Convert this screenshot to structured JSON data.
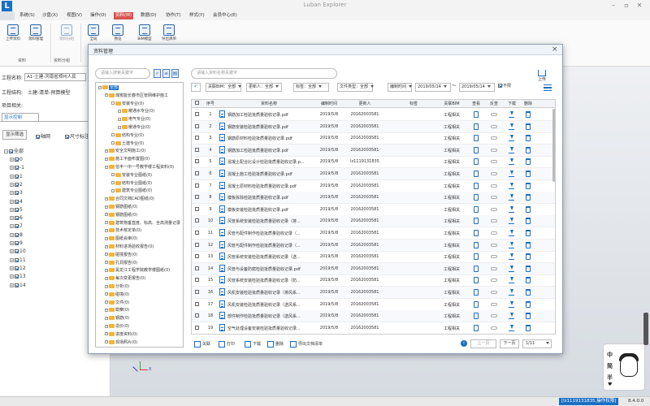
{
  "app": {
    "title": "Luban Explorer",
    "logo": "L"
  },
  "menu": [
    "系统(S)",
    "沙盘(X)",
    "视图(V)",
    "操作(O)",
    "资料(M)",
    "数据(D)",
    "协作(T)",
    "样式(Y)",
    "会员中心(E)"
  ],
  "menu_active": 4,
  "ribbon": {
    "buttons": [
      "上传资料",
      "资料管理",
      "资料分组",
      "全局",
      "预览",
      "BIM模型",
      "导出清单"
    ],
    "groups": [
      "资料",
      "资料分组"
    ]
  },
  "left": {
    "project_label": "工程名称:",
    "project_value": "A1-土建-河南省郑州人民",
    "struct_label": "工程结构:",
    "struct_value": "土建-清单-预算模型",
    "item_label": "项目相关:",
    "tab": "显示控制",
    "btn_filter": "显示筛选",
    "cb_grid": "轴网",
    "cb_size": "尺寸标注",
    "tree_root": "全部",
    "tree_items": [
      "0",
      "-1",
      "1",
      "2",
      "3",
      "4",
      "5",
      "6",
      "7",
      "8",
      "9",
      "10",
      "11",
      "12",
      "13",
      "14"
    ]
  },
  "dialog": {
    "title": "资料管理",
    "close": "×",
    "tree_search_placeholder": "请输入搜索关键字",
    "table_search_placeholder": "请输入资料名称关键字",
    "upload": "上传",
    "filters": [
      "关联BIM：全部",
      "更新人：全部",
      "标签：全部",
      "文件类型：全部",
      "编制时间"
    ],
    "date_from": "2019/05/14",
    "date_sep": "～",
    "date_to": "2019/05/14",
    "cb_unlimited": "不限",
    "tree": [
      {
        "label": "全部",
        "level": 0,
        "selected": true
      },
      {
        "label": "煤炭能长春市区管网维护施工",
        "level": 1
      },
      {
        "label": "安装专业(0)",
        "level": 2
      },
      {
        "label": "暖通水专业(0)",
        "level": 3
      },
      {
        "label": "电气专业(0)",
        "level": 3
      },
      {
        "label": "暖通专业(0)",
        "level": 3
      },
      {
        "label": "结构专业(0)",
        "level": 2
      },
      {
        "label": "土建专业(0)",
        "level": 2
      },
      {
        "label": "安全文明施工(0)",
        "level": 1
      },
      {
        "label": "施工平面布置图(0)",
        "level": 1
      },
      {
        "label": "信丰一中一号教学楼工程资料(0)",
        "level": 1
      },
      {
        "label": "安装专业图纸(0)",
        "level": 2
      },
      {
        "label": "结构专业图纸(0)",
        "level": 2
      },
      {
        "label": "建筑专业图纸(0)",
        "level": 2
      },
      {
        "label": "合同文档CAD图纸(0)",
        "level": 1
      },
      {
        "label": "钢筋图纸(0)",
        "level": 1
      },
      {
        "label": "钢筋图纸(0)",
        "level": 1
      },
      {
        "label": "建筑物垂直度、标高、全高测量记录",
        "level": 1
      },
      {
        "label": "技术核定单(0)",
        "level": 1
      },
      {
        "label": "图纸会审(0)",
        "level": 1
      },
      {
        "label": "材料进场验收报告(0)",
        "level": 1
      },
      {
        "label": "碰撞报告(0)",
        "level": 1
      },
      {
        "label": "孔洞报告(0)",
        "level": 1
      },
      {
        "label": "黑龙江工程学院教学楼图纸(0)",
        "level": 1
      },
      {
        "label": "每次变更报告(0)",
        "level": 1
      },
      {
        "label": "分析(0)",
        "level": 1
      },
      {
        "label": "碰撞(0)",
        "level": 1
      },
      {
        "label": "文件(0)",
        "level": 1
      },
      {
        "label": "勘察(0)",
        "level": 1
      },
      {
        "label": "钢筋(0)",
        "level": 1
      },
      {
        "label": "造价(0)",
        "level": 1
      },
      {
        "label": "进度资料(0)",
        "level": 1
      },
      {
        "label": "现场照片(0)",
        "level": 1
      }
    ],
    "columns": [
      "序号",
      "资料名称",
      "编制时间",
      "更新人",
      "标签",
      "关联BIM",
      "查看",
      "反查",
      "下载",
      "删除"
    ],
    "rows": [
      {
        "no": "1",
        "name": "钢筋加工检验批质量验收记录.pdf",
        "date": "2019/5/8",
        "user": "20162003581",
        "bim": "工程相关"
      },
      {
        "no": "2",
        "name": "钢筋安装检验批质量验收记录.pdf",
        "date": "2019/5/8",
        "user": "20162003581",
        "bim": "工程相关"
      },
      {
        "no": "3",
        "name": "钢筋原材料检验批质量验收记录.pdf",
        "date": "2019/5/8",
        "user": "20162003581",
        "bim": "工程相关"
      },
      {
        "no": "4",
        "name": "钢筋加工检验批质量验收记录.pdf",
        "date": "2019/5/8",
        "user": "20162003581",
        "bim": "工程相关"
      },
      {
        "no": "5",
        "name": "混凝土配合比设计检验批质量验收记录.p...",
        "date": "2019/5/8",
        "user": "lz1119131835",
        "bim": "工程相关"
      },
      {
        "no": "6",
        "name": "混凝土施工检验批质量验收记录.pdf",
        "date": "2019/5/8",
        "user": "20162003581",
        "bim": "工程相关"
      },
      {
        "no": "7",
        "name": "混凝土原材料检验批质量验收记录.pdf",
        "date": "2019/5/8",
        "user": "20162003581",
        "bim": "工程相关"
      },
      {
        "no": "8",
        "name": "模板拆除检验批质量验收记录.pdf",
        "date": "2019/5/8",
        "user": "20162003581",
        "bim": "工程相关"
      },
      {
        "no": "9",
        "name": "模板安装检验批质量验收记录.pdf",
        "date": "2019/5/8",
        "user": "20162003581",
        "bim": "工程相关"
      },
      {
        "no": "10",
        "name": "风管系统安装检验批质量验收记录（排...",
        "date": "2019/5/8",
        "user": "20162003581",
        "bim": "工程相关"
      },
      {
        "no": "11",
        "name": "风管与配件制作检验批质量验收记录（...",
        "date": "2019/5/8",
        "user": "20162003581",
        "bim": "工程相关"
      },
      {
        "no": "12",
        "name": "风管与配件制作检验批质量验收记录（...",
        "date": "2019/5/8",
        "user": "20162003581",
        "bim": "工程相关"
      },
      {
        "no": "13",
        "name": "风管系统安装检验批质量验收记录（送...",
        "date": "2019/5/8",
        "user": "20162003581",
        "bim": "工程相关"
      },
      {
        "no": "14",
        "name": "风管与设备防腐检验批质量验收记录.pdf",
        "date": "2019/5/8",
        "user": "20162003581",
        "bim": "工程相关"
      },
      {
        "no": "15",
        "name": "风管系统安装检验批质量验收记录（防...",
        "date": "2019/5/8",
        "user": "20162003581",
        "bim": "工程相关"
      },
      {
        "no": "16",
        "name": "风机安装检验批质量验收记录（排风系...",
        "date": "2019/5/8",
        "user": "20162003581",
        "bim": "工程相关"
      },
      {
        "no": "17",
        "name": "风机安装检验批质量验收记录（送风系...",
        "date": "2019/5/8",
        "user": "20162003581",
        "bim": "工程相关"
      },
      {
        "no": "18",
        "name": "部件制作检验批质量验收记录（送风系...",
        "date": "2019/5/8",
        "user": "20162003581",
        "bim": "工程相关"
      },
      {
        "no": "19",
        "name": "空气处理设备安装检验批质量验收记录...",
        "date": "2019/5/8",
        "user": "20162003581",
        "bim": "工程相关"
      }
    ],
    "bottom": {
      "link": "关联",
      "print": "打印",
      "download": "下载",
      "delete": "删除",
      "export": "导出文档清单"
    },
    "pager": {
      "prev": "上一页",
      "next": "下一页",
      "page": "1/11"
    }
  },
  "mascot": {
    "line1": "中",
    "line2": "简",
    "line3": "半"
  },
  "status": {
    "user": "[lz1119131835,操作权限]",
    "version": "8.4.0.0"
  }
}
